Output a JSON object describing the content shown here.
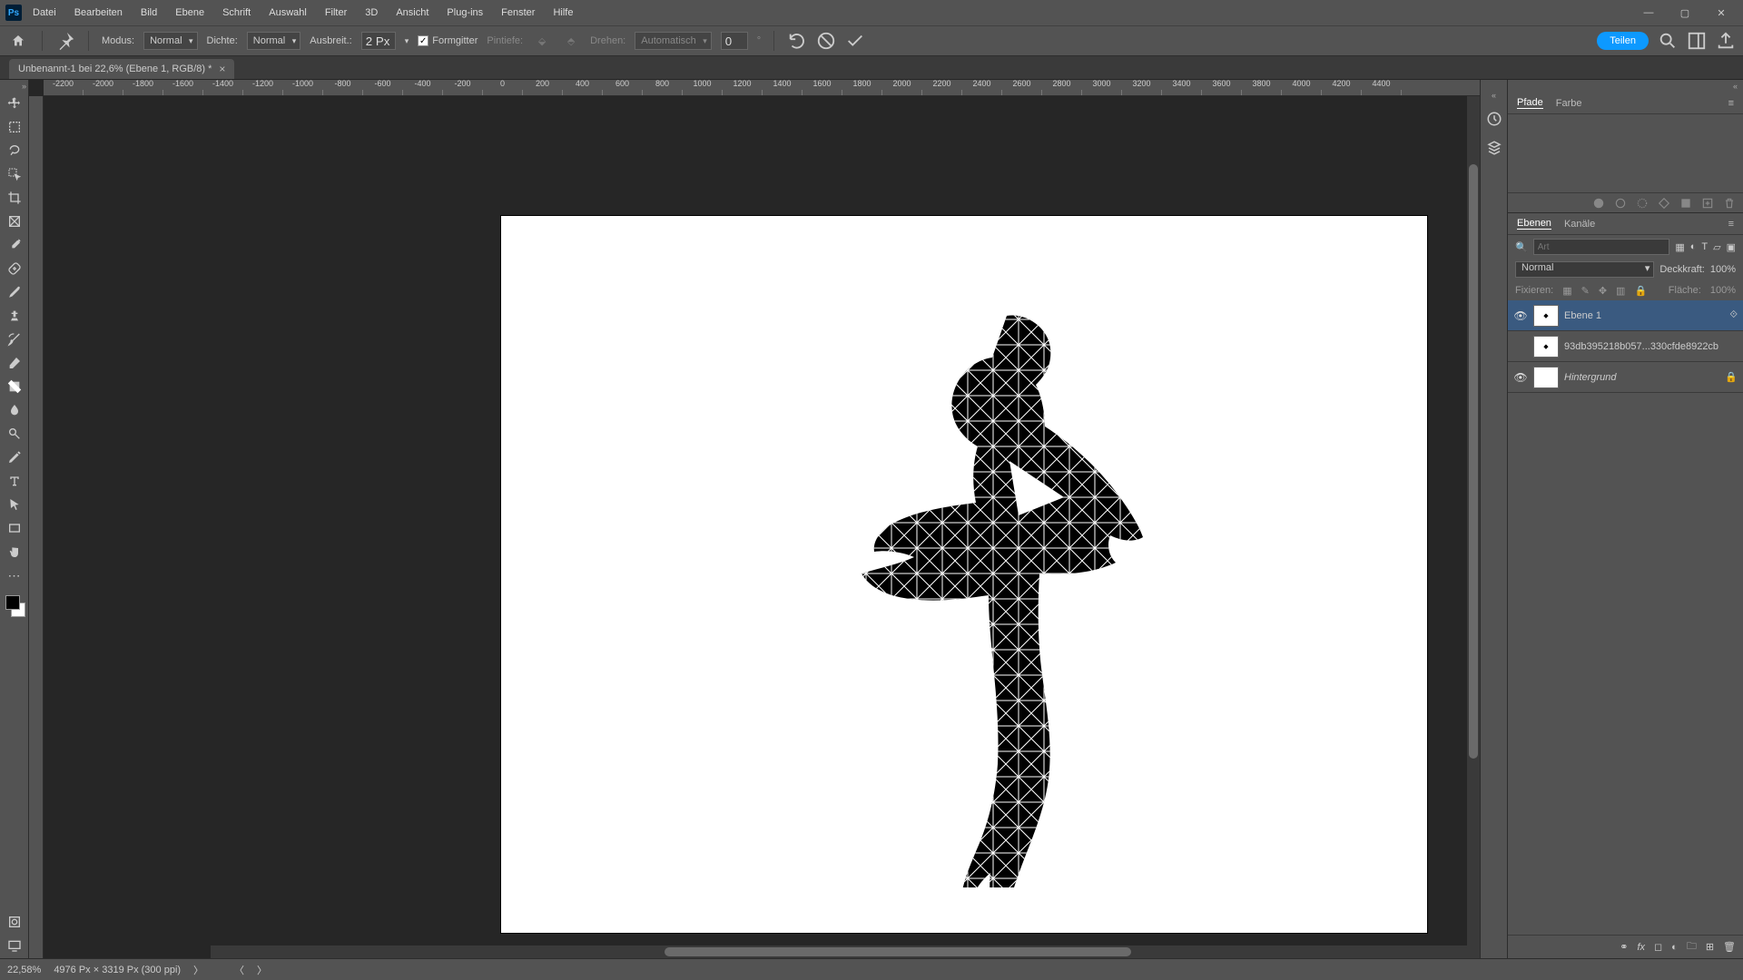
{
  "app": {
    "ps_label": "Ps"
  },
  "menu": [
    "Datei",
    "Bearbeiten",
    "Bild",
    "Ebene",
    "Schrift",
    "Auswahl",
    "Filter",
    "3D",
    "Ansicht",
    "Plug-ins",
    "Fenster",
    "Hilfe"
  ],
  "options_bar": {
    "modus_label": "Modus:",
    "modus_value": "Normal",
    "dichte_label": "Dichte:",
    "dichte_value": "Normal",
    "ausbreit_label": "Ausbreit.:",
    "ausbreit_value": "2 Px",
    "formgitter_label": "Formgitter",
    "formgitter_checked": true,
    "pinfefe_label": "Pintiefe:",
    "drehen_label": "Drehen:",
    "drehen_value": "Automatisch",
    "angle_value": "0",
    "angle_unit": "°"
  },
  "header_right": {
    "share_label": "Teilen"
  },
  "document_tab": {
    "title": "Unbenannt-1 bei 22,6% (Ebene 1, RGB/8) *"
  },
  "ruler_ticks": [
    "-2200",
    "-2000",
    "-1800",
    "-1600",
    "-1400",
    "-1200",
    "-1000",
    "-800",
    "-600",
    "-400",
    "-200",
    "0",
    "200",
    "400",
    "600",
    "800",
    "1000",
    "1200",
    "1400",
    "1600",
    "1800",
    "2000",
    "2200",
    "2400",
    "2600",
    "2800",
    "3000",
    "3200",
    "3400",
    "3600",
    "3800",
    "4000",
    "4200",
    "4400"
  ],
  "panel_tabs_top": {
    "pfade": "Pfade",
    "farbe": "Farbe"
  },
  "panel_tabs_layers": {
    "ebenen": "Ebenen",
    "kanaele": "Kanäle"
  },
  "layers_panel": {
    "filter_placeholder": "Art",
    "blend_label": "Normal",
    "opacity_label": "Deckkraft:",
    "opacity_value": "100%",
    "lock_label": "Fixieren:",
    "fill_label": "Fläche:",
    "fill_value": "100%",
    "layers": [
      {
        "name": "Ebene 1",
        "visible": true,
        "active": true,
        "italic": false,
        "thumb": "◆"
      },
      {
        "name": "93db395218b057...330cfde8922cb",
        "visible": false,
        "active": false,
        "italic": false,
        "thumb": "◆"
      },
      {
        "name": "Hintergrund",
        "visible": true,
        "active": false,
        "italic": true,
        "thumb": ""
      }
    ]
  },
  "status_bar": {
    "zoom": "22,58%",
    "docinfo": "4976 Px × 3319 Px (300 ppi)"
  },
  "tools": [
    "move-tool",
    "rect-marquee-tool",
    "lasso-tool",
    "magic-wand-tool",
    "crop-tool",
    "frame-tool",
    "eyedropper-tool",
    "spot-heal-tool",
    "brush-tool",
    "clone-stamp-tool",
    "history-brush-tool",
    "eraser-tool",
    "gradient-tool",
    "blur-tool",
    "dodge-tool",
    "pen-tool",
    "type-tool",
    "path-select-tool",
    "rectangle-tool",
    "hand-tool",
    "zoom-tool"
  ]
}
